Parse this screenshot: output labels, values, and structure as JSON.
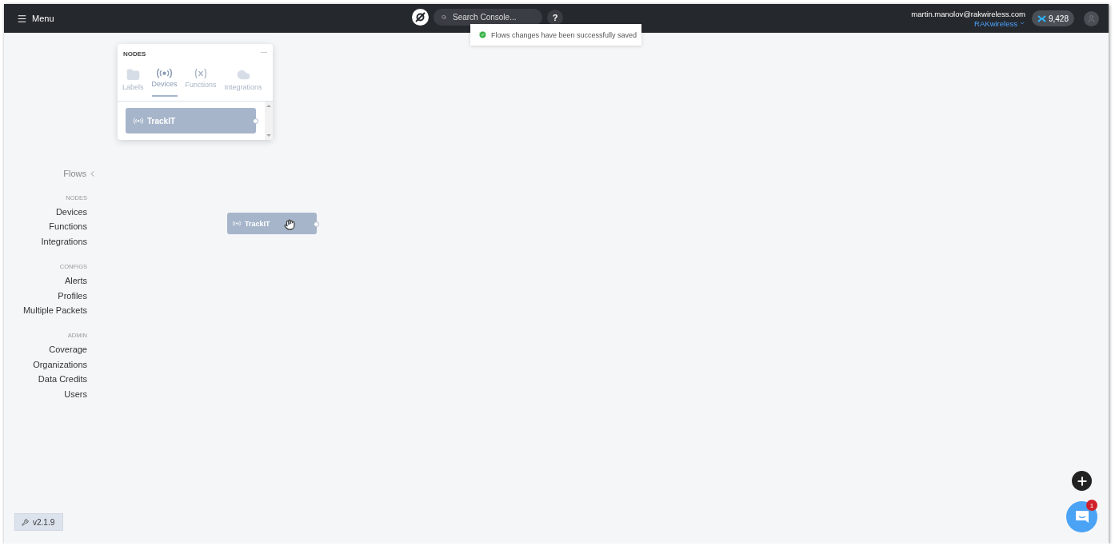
{
  "header": {
    "menu_label": "Menu",
    "search": {
      "placeholder": "Search Console..."
    },
    "help": "?",
    "user_email": "martin.manolov@rakwireless.com",
    "organization": "RAKwireless",
    "credits": "9,428"
  },
  "toast": {
    "message": "Flows changes have been successfully saved"
  },
  "palette": {
    "title": "NODES",
    "tabs": [
      {
        "label": "Labels",
        "kind": "folder",
        "selected": false
      },
      {
        "label": "Devices",
        "kind": "device",
        "selected": true
      },
      {
        "label": "Functions",
        "kind": "function",
        "selected": false
      },
      {
        "label": "Integrations",
        "kind": "cloud",
        "selected": false
      }
    ],
    "items": [
      {
        "label": "TrackIT"
      }
    ]
  },
  "sidebar": {
    "title": "Flows",
    "sections": [
      {
        "heading": "NODES",
        "items": [
          "Devices",
          "Functions",
          "Integrations"
        ]
      },
      {
        "heading": "CONFIGS",
        "items": [
          "Alerts",
          "Profiles",
          "Multiple Packets"
        ]
      },
      {
        "heading": "ADMIN",
        "items": [
          "Coverage",
          "Organizations",
          "Data Credits",
          "Users"
        ]
      }
    ]
  },
  "canvas_nodes": [
    {
      "label": "TrackIT"
    }
  ],
  "version": "v2.1.9",
  "chat": {
    "badge": "1"
  }
}
